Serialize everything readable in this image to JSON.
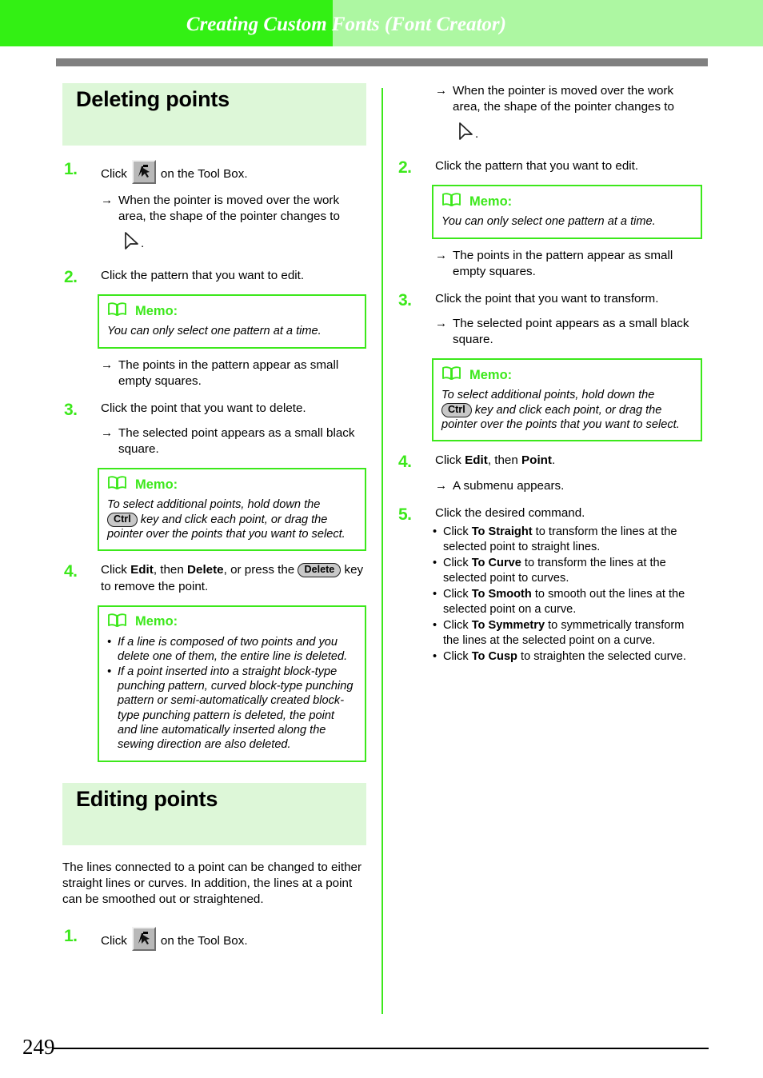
{
  "header": {
    "title": "Creating Custom Fonts (Font Creator)"
  },
  "footer": {
    "page_number": "249"
  },
  "left_column": {
    "section_title": "Deleting points",
    "steps": [
      {
        "number": "1.",
        "text_before_icon": "Click",
        "icon": "select-point-tool-icon",
        "text_after_icon": "on the Tool Box.",
        "result_line1": "When the pointer is moved over the work",
        "result_line2": "area, the shape of the pointer changes to",
        "result_glyph": "pointer-arrow-glyph",
        "result_period": "."
      },
      {
        "number": "2.",
        "text": "Click the pattern that you want to edit.",
        "memo": {
          "label": "Memo:",
          "text": "You can only select one pattern at a time."
        },
        "result": "The points in the pattern appear as small empty squares."
      },
      {
        "number": "3.",
        "text": "Click the point that you want to delete.",
        "result": "The selected point appears as a small black square.",
        "memo": {
          "label": "Memo:",
          "text_part1": "To select additional points, hold down the",
          "key": "Ctrl",
          "text_part2": "key and click each point, or drag the pointer over the points that you want to select."
        }
      },
      {
        "number": "4.",
        "text_part1": "Click ",
        "bold1": "Edit",
        "text_part2": ", then ",
        "bold2": "Delete",
        "text_part3": ", or press the ",
        "key": "Delete",
        "text_part4": " key to remove the point.",
        "memo": {
          "label": "Memo:",
          "bullets": [
            "If a line is composed of two points and you delete one of them, the entire line is deleted.",
            "If a point inserted into a straight block-type punching pattern, curved block-type punching pattern or semi-automatically created block-type punching pattern is deleted, the point and line automatically inserted along the sewing direction are also deleted."
          ]
        }
      }
    ],
    "section2_title": "Editing points",
    "section2_paragraph": "The lines connected to a point can be changed to either straight lines or curves. In addition, the lines at a point can be smoothed out or straightened.",
    "section2_step": {
      "number": "1.",
      "text_before_icon": "Click",
      "icon": "select-point-tool-icon",
      "text_after_icon": "on the Tool Box."
    }
  },
  "right_column": {
    "continued_result_line1": "When the pointer is moved over the work",
    "continued_result_line2": "area, the shape of the pointer changes to",
    "continued_glyph": "pointer-arrow-glyph",
    "continued_period": ".",
    "steps": [
      {
        "number": "2.",
        "text": "Click the pattern that you want to edit.",
        "memo": {
          "label": "Memo:",
          "text": "You can only select one pattern at a time."
        },
        "result": "The points in the pattern appear as small empty squares."
      },
      {
        "number": "3.",
        "text": "Click the point that you want to transform.",
        "result": "The selected point appears as a small black square.",
        "memo": {
          "label": "Memo:",
          "text_part1": "To select additional points, hold down the",
          "key": "Ctrl",
          "text_part2": "key and click each point, or drag the pointer over the points that you want to select."
        }
      },
      {
        "number": "4.",
        "text_part1": "Click ",
        "bold1": "Edit",
        "text_part2": ", then ",
        "bold2": "Point",
        "text_part3": ".",
        "result": "A submenu appears."
      },
      {
        "number": "5.",
        "text": "Click the desired command.",
        "bullets": [
          {
            "pre": "Click ",
            "bold": "To Straight",
            "post": " to transform the lines at the selected point to straight lines."
          },
          {
            "pre": "Click ",
            "bold": "To Curve",
            "post": " to transform the lines at the selected point to curves."
          },
          {
            "pre": "Click ",
            "bold": "To Smooth",
            "post": " to smooth out the lines at the selected point on a curve."
          },
          {
            "pre": "Click ",
            "bold": "To Symmetry",
            "post": " to symmetrically transform the lines at the selected point on a curve."
          },
          {
            "pre": "Click ",
            "bold": "To Cusp",
            "post": " to straighten the selected curve."
          }
        ]
      }
    ]
  },
  "colors": {
    "header_dark_green": "#33f014",
    "header_light_green": "#adf7a2",
    "accent_green": "#3ce81b",
    "section_bg": "#ddf7d8",
    "rule_gray": "#808080"
  }
}
